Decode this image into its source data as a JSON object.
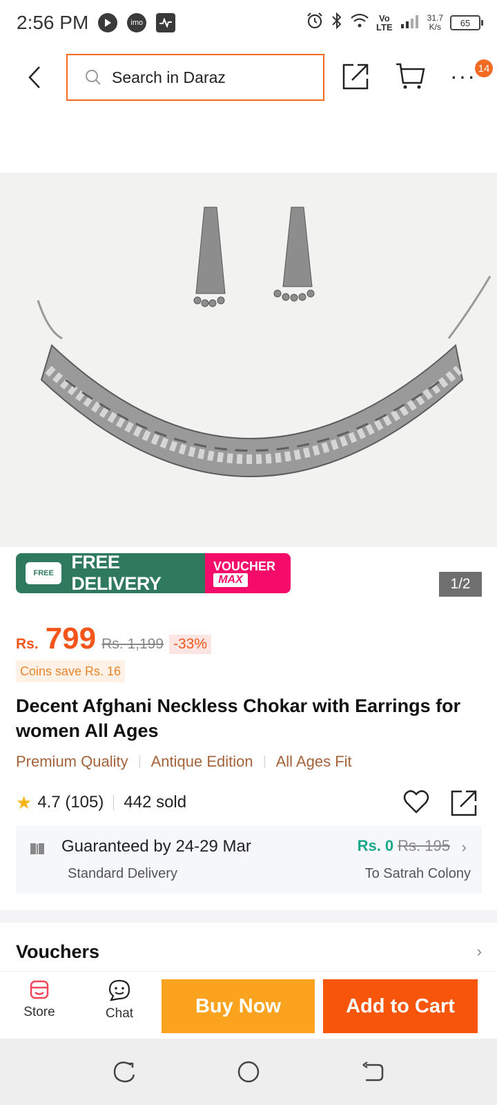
{
  "status_bar": {
    "time": "2:56 PM",
    "left_icons": [
      "play-icon",
      "imo-icon",
      "activity-icon"
    ],
    "imo_label": "imo",
    "right_icons": [
      "alarm-icon",
      "bluetooth-icon",
      "wifi-icon",
      "signal-icon"
    ],
    "network": "Vo\nLTE",
    "speed": "31.7\nK/s",
    "battery": "65"
  },
  "top_bar": {
    "search_placeholder": "Search in Daraz",
    "more_label": "···",
    "cart_badge": "14"
  },
  "gallery": {
    "description_icon": "product-photo",
    "counter": "1/2"
  },
  "promo": {
    "free_delivery": "FREE DELIVERY",
    "free_small": "FREE",
    "voucher_line1": "VOUCHER",
    "voucher_line2": "MAX",
    "colors": {
      "free_delivery_bg": "#2f7a5f",
      "voucher_bg": "#f50c6b"
    }
  },
  "price": {
    "currency": "Rs.",
    "value": "799",
    "original": "Rs. 1,199",
    "discount": "-33%",
    "coins_note": "Coins save Rs. 16"
  },
  "product": {
    "title": "Decent Afghani Neckless Chokar with Earrings for women All Ages",
    "tags": [
      "Premium Quality",
      "Antique Edition",
      "All Ages Fit"
    ],
    "rating": "4.7 (105)",
    "sold": "442 sold"
  },
  "delivery": {
    "title": "Guaranteed by 24-29 Mar",
    "subtitle": "Standard Delivery",
    "price_new": "Rs. 0",
    "price_old": "Rs. 195",
    "destination": "To Satrah Colony"
  },
  "vouchers": {
    "label": "Vouchers"
  },
  "bottom_bar": {
    "store": "Store",
    "chat": "Chat",
    "buy_now": "Buy Now",
    "add_to_cart": "Add to Cart",
    "colors": {
      "buy_now": "#fba31f",
      "add_to_cart": "#f6550a",
      "accent": "#f36a23"
    }
  }
}
